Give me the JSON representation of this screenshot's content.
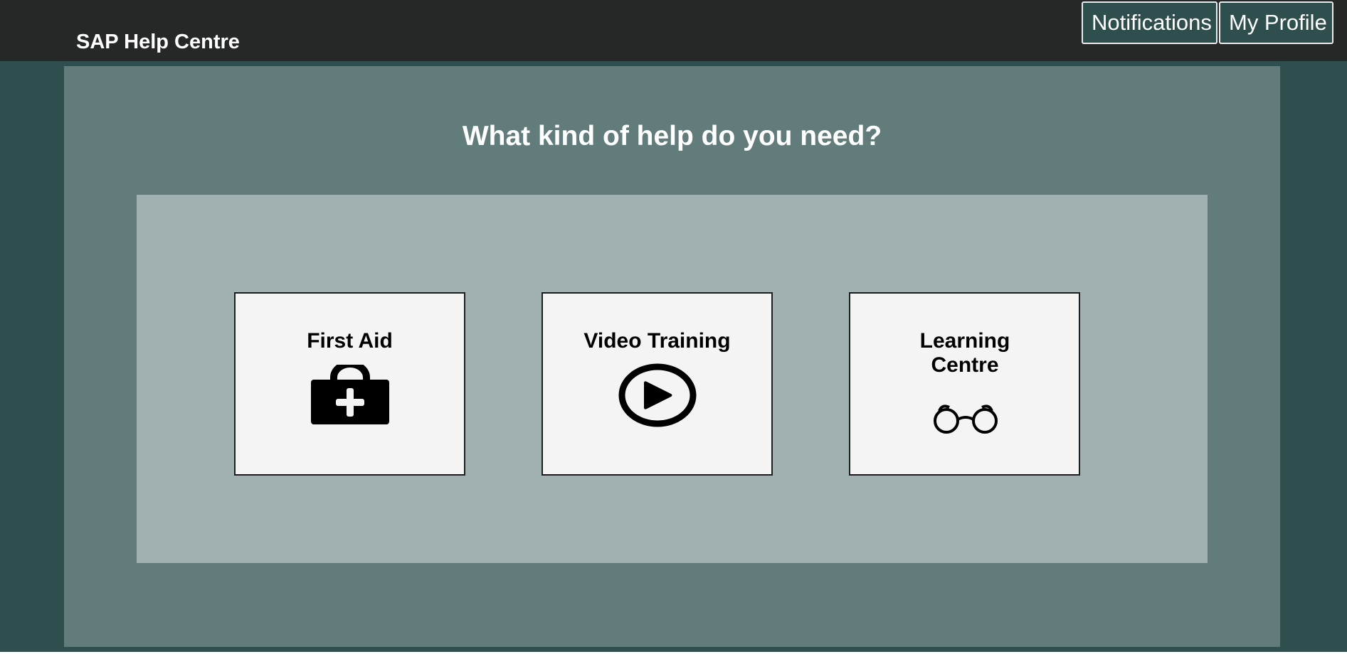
{
  "header": {
    "title": "SAP Help Centre",
    "nav": {
      "notifications_label": "Notifications",
      "profile_label": "My Profile"
    }
  },
  "main": {
    "question": "What kind of help do you need?",
    "cards": [
      {
        "label": "First Aid",
        "icon": "first-aid-kit-icon"
      },
      {
        "label": "Video Training",
        "icon": "play-icon"
      },
      {
        "label": "Learning Centre",
        "icon": "glasses-icon"
      }
    ]
  },
  "colors": {
    "topbar": "#262828",
    "page_background": "#2f4f4f",
    "main_panel": "#627b7b",
    "inner_panel": "#a1b1b1",
    "card_background": "#f4f4f4",
    "text_light": "#ffffff",
    "text_dark": "#000000"
  }
}
